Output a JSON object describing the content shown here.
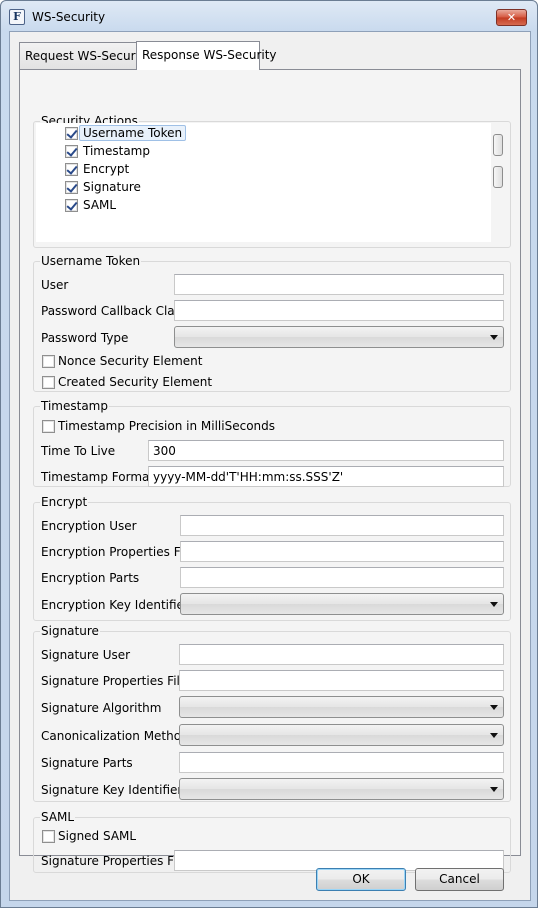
{
  "window": {
    "title": "WS-Security",
    "close_label": "✕",
    "icon_glyph": "F"
  },
  "tabs": [
    {
      "label": "Request WS-Security",
      "active": false
    },
    {
      "label": "Response WS-Security",
      "active": true
    }
  ],
  "security_actions": {
    "title": "Security Actions",
    "items": [
      {
        "label": "Username Token",
        "checked": true,
        "selected": true
      },
      {
        "label": "Timestamp",
        "checked": true
      },
      {
        "label": "Encrypt",
        "checked": true
      },
      {
        "label": "Signature",
        "checked": true
      },
      {
        "label": "SAML",
        "checked": true
      }
    ]
  },
  "username_token": {
    "title": "Username Token",
    "user_label": "User",
    "user_value": "",
    "password_callback_label": "Password Callback Class",
    "password_callback_value": "",
    "password_type_label": "Password Type",
    "password_type_value": "",
    "nonce_label": "Nonce Security Element",
    "nonce_checked": false,
    "created_label": "Created Security Element",
    "created_checked": false
  },
  "timestamp": {
    "title": "Timestamp",
    "precision_label": "Timestamp Precision in MilliSeconds",
    "precision_checked": false,
    "ttl_label": "Time To Live",
    "ttl_value": "300",
    "format_label": "Timestamp Format",
    "format_value": "yyyy-MM-dd'T'HH:mm:ss.SSS'Z'"
  },
  "encrypt": {
    "title": "Encrypt",
    "user_label": "Encryption User",
    "user_value": "",
    "properties_label": "Encryption Properties File",
    "properties_value": "",
    "parts_label": "Encryption Parts",
    "parts_value": "",
    "key_id_label": "Encryption Key Identifier",
    "key_id_value": ""
  },
  "signature": {
    "title": "Signature",
    "user_label": "Signature User",
    "user_value": "",
    "properties_label": "Signature Properties File",
    "properties_value": "",
    "algorithm_label": "Signature Algorithm",
    "algorithm_value": "",
    "canon_label": "Canonicalization Method",
    "canon_value": "",
    "parts_label": "Signature Parts",
    "parts_value": "",
    "key_id_label": "Signature Key Identifier",
    "key_id_value": ""
  },
  "saml": {
    "title": "SAML",
    "signed_label": "Signed SAML",
    "signed_checked": false,
    "properties_label": "Signature Properties File",
    "properties_value": ""
  },
  "buttons": {
    "ok": "OK",
    "cancel": "Cancel"
  }
}
